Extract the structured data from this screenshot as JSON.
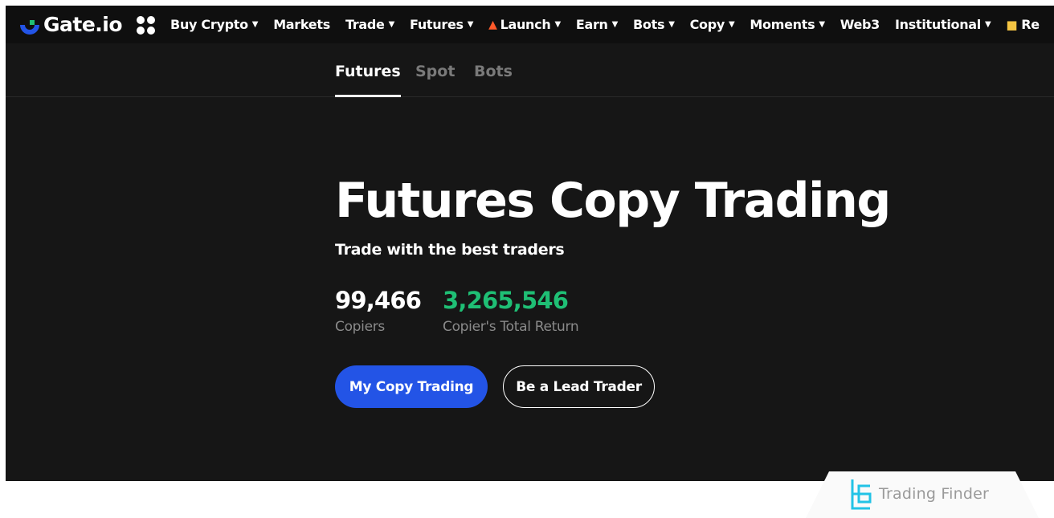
{
  "brand": {
    "name": "Gate.io",
    "logo_icon": "gate-logo-icon",
    "logo_color": "#2354e6",
    "accent_green": "#1fbf75"
  },
  "nav": {
    "items": [
      {
        "label": "Buy Crypto",
        "dropdown": true
      },
      {
        "label": "Markets",
        "dropdown": false
      },
      {
        "label": "Trade",
        "dropdown": true
      },
      {
        "label": "Futures",
        "dropdown": true
      },
      {
        "label": "Launch",
        "dropdown": true,
        "icon": "flame-icon"
      },
      {
        "label": "Earn",
        "dropdown": true
      },
      {
        "label": "Bots",
        "dropdown": true
      },
      {
        "label": "Copy",
        "dropdown": true
      },
      {
        "label": "Moments",
        "dropdown": true
      },
      {
        "label": "Web3",
        "dropdown": false
      },
      {
        "label": "Institutional",
        "dropdown": true
      },
      {
        "label": "Re",
        "dropdown": false,
        "icon": "gift-icon"
      }
    ]
  },
  "subtabs": [
    {
      "label": "Futures",
      "active": true
    },
    {
      "label": "Spot",
      "active": false
    },
    {
      "label": "Bots",
      "active": false
    }
  ],
  "hero": {
    "title": "Futures Copy Trading",
    "subtitle": "Trade with the best traders",
    "stats": [
      {
        "value": "99,466",
        "label": "Copiers",
        "color": "#ffffff"
      },
      {
        "value": "3,265,546",
        "label": "Copier's Total Return",
        "color": "#1fbf75"
      }
    ],
    "primary_button": "My Copy Trading",
    "secondary_button": "Be a Lead Trader",
    "primary_color": "#2354e6"
  },
  "watermark": {
    "text": "Trading Finder",
    "icon": "trading-finder-logo-icon",
    "icon_color": "#22c3e6"
  }
}
